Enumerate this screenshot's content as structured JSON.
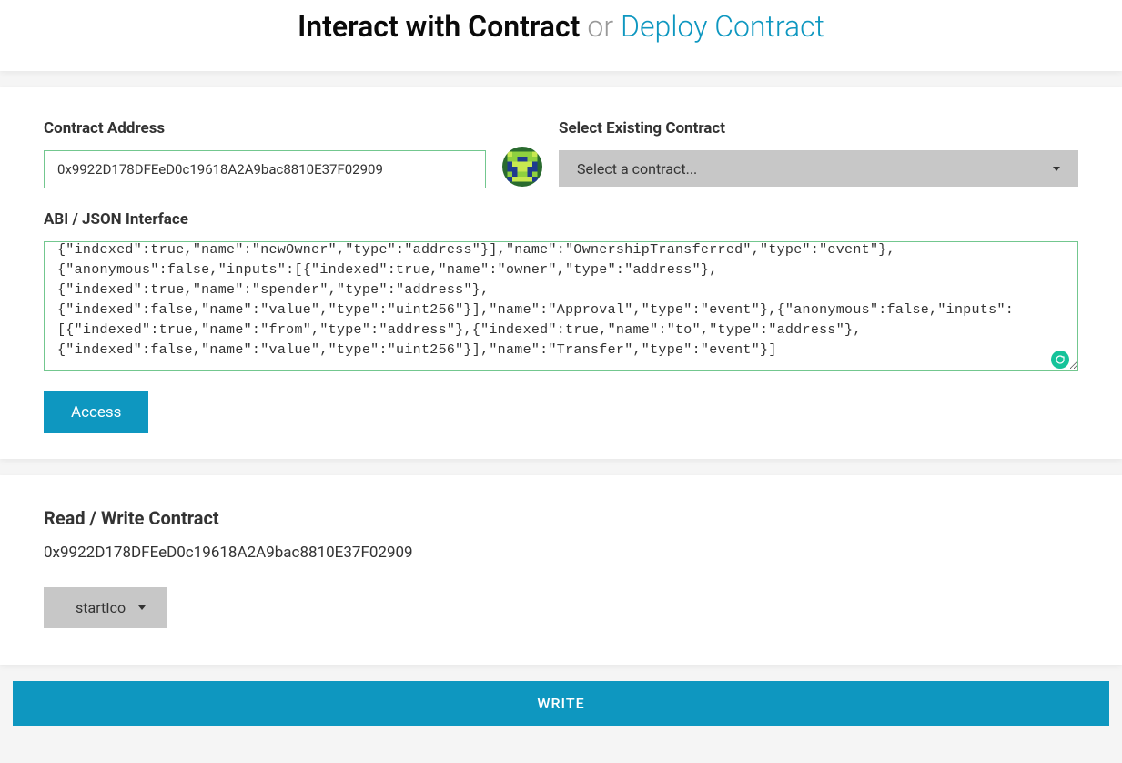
{
  "header": {
    "interact_label": "Interact with Contract",
    "or_label": "or",
    "deploy_label": "Deploy Contract"
  },
  "form": {
    "address_label": "Contract Address",
    "address_value": "0x9922D178DFEeD0c19618A2A9bac8810E37F02909",
    "existing_label": "Select Existing Contract",
    "existing_placeholder": "Select a contract...",
    "abi_label": "ABI / JSON Interface",
    "abi_value": "{\"indexed\":true,\"name\":\"newOwner\",\"type\":\"address\"}],\"name\":\"OwnershipTransferred\",\"type\":\"event\"},{\"anonymous\":false,\"inputs\":[{\"indexed\":true,\"name\":\"owner\",\"type\":\"address\"},{\"indexed\":true,\"name\":\"spender\",\"type\":\"address\"},{\"indexed\":false,\"name\":\"value\",\"type\":\"uint256\"}],\"name\":\"Approval\",\"type\":\"event\"},{\"anonymous\":false,\"inputs\":[{\"indexed\":true,\"name\":\"from\",\"type\":\"address\"},{\"indexed\":true,\"name\":\"to\",\"type\":\"address\"},{\"indexed\":false,\"name\":\"value\",\"type\":\"uint256\"}],\"name\":\"Transfer\",\"type\":\"event\"}]",
    "access_label": "Access"
  },
  "rw": {
    "title": "Read / Write Contract",
    "address": "0x9922D178DFEeD0c19618A2A9bac8810E37F02909",
    "selected_function": "startIco",
    "write_label": "WRITE"
  },
  "colors": {
    "primary": "#0e97c0",
    "success_border": "#73c78f",
    "dropdown_bg": "#c7c7c7"
  }
}
